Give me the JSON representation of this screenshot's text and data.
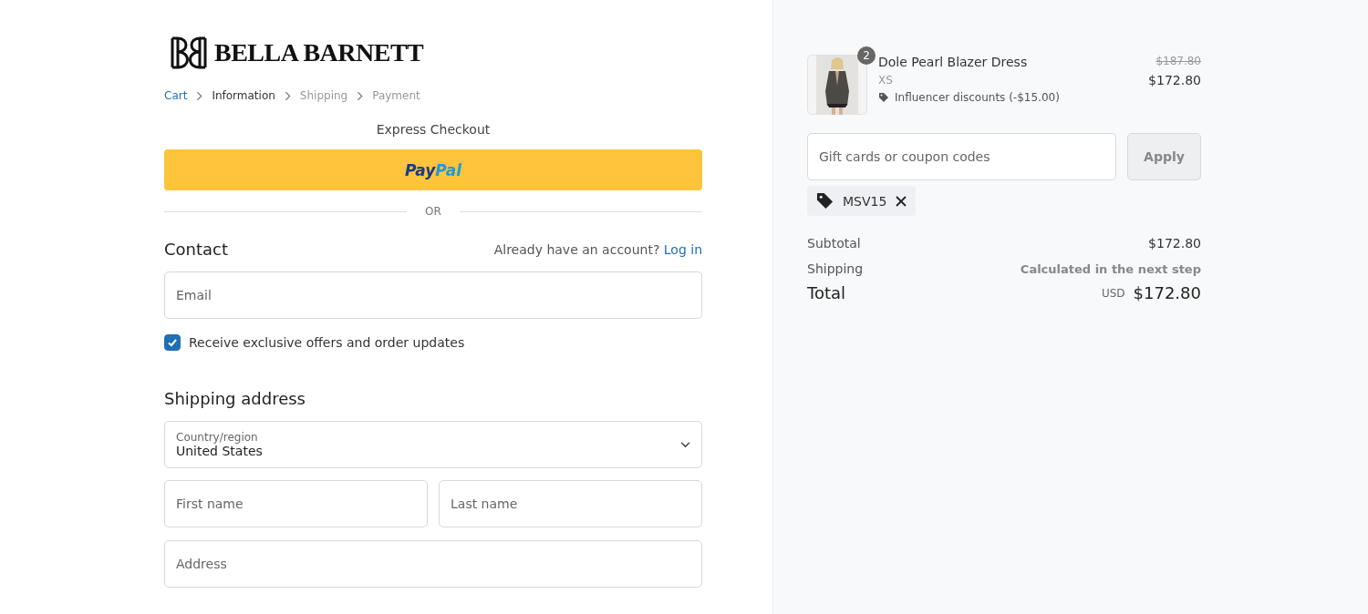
{
  "brand": {
    "name": "BELLA BARNETT"
  },
  "breadcrumb": [
    {
      "label": "Cart",
      "kind": "link"
    },
    {
      "label": "Information",
      "kind": "current"
    },
    {
      "label": "Shipping",
      "kind": "upcoming"
    },
    {
      "label": "Payment",
      "kind": "upcoming"
    }
  ],
  "express_checkout": {
    "title": "Express Checkout",
    "button": {
      "label_dark": "Pay",
      "label_light": "Pal"
    },
    "divider": "OR"
  },
  "contact": {
    "title": "Contact",
    "account_prompt": "Already have an account?",
    "login_link": "Log in",
    "email": {
      "placeholder": "Email"
    },
    "marketing": {
      "label": "Receive exclusive offers and order updates",
      "checked": true
    }
  },
  "shipping_address": {
    "title": "Shipping address",
    "country": {
      "label": "Country/region",
      "value": "United States"
    },
    "first_name": {
      "placeholder": "First name"
    },
    "last_name": {
      "placeholder": "Last name"
    },
    "address": {
      "placeholder": "Address"
    }
  },
  "order_summary": {
    "item": {
      "quantity": "2",
      "name": "Dole Pearl Blazer Dress",
      "variant": "XS",
      "discount": "Influencer discounts (-$15.00)",
      "original_price": "$187.80",
      "price": "$172.80"
    },
    "coupon": {
      "placeholder": "Gift cards or coupon codes",
      "button": "Apply"
    },
    "applied_code": "MSV15",
    "subtotal": {
      "label": "Subtotal",
      "value": "$172.80"
    },
    "shipping": {
      "label": "Shipping",
      "value": "Calculated in the next step"
    },
    "total": {
      "label": "Total",
      "currency": "USD",
      "value": "$172.80"
    }
  }
}
